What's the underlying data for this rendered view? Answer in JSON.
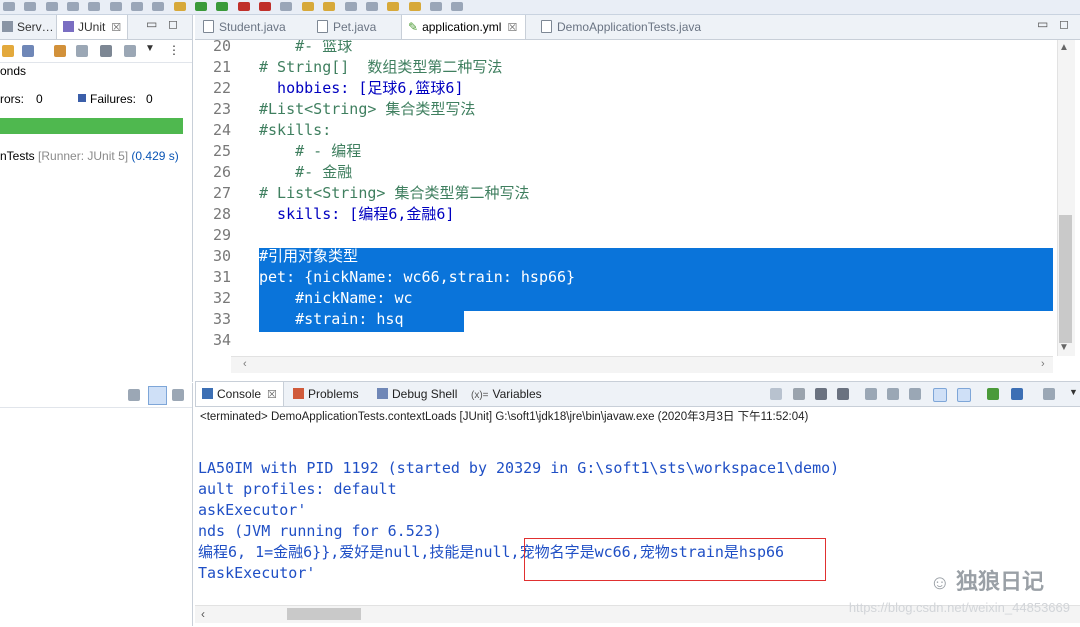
{
  "left_panel": {
    "tabs": [
      {
        "label": "Serv…"
      },
      {
        "label": "JUnit"
      }
    ],
    "elapsed_label": "onds",
    "errors_label": "rors:",
    "errors_value": "0",
    "failures_label": "Failures:",
    "failures_value": "0",
    "test_name": "nTests",
    "runner": "[Runner: JUnit 5]",
    "duration": "(0.429 s)"
  },
  "editor": {
    "tabs": [
      {
        "label": "Student.java",
        "active": false
      },
      {
        "label": "Pet.java",
        "active": false
      },
      {
        "label": "application.yml",
        "active": true
      },
      {
        "label": "DemoApplicationTests.java",
        "active": false
      }
    ],
    "lines": [
      {
        "num": "20",
        "text": "    #- 篮球",
        "cls": "cmt",
        "sel": false
      },
      {
        "num": "21",
        "text": "# String[]  数组类型第二种写法",
        "cls": "cmt",
        "sel": false
      },
      {
        "num": "22",
        "text": "  hobbies: [足球6,篮球6]",
        "cls": "key",
        "sel": false
      },
      {
        "num": "23",
        "text": "#List<String> 集合类型写法",
        "cls": "cmt",
        "sel": false
      },
      {
        "num": "24",
        "text": "#skills:",
        "cls": "cmt",
        "sel": false
      },
      {
        "num": "25",
        "text": "    # - 编程",
        "cls": "cmt",
        "sel": false
      },
      {
        "num": "26",
        "text": "    #- 金融",
        "cls": "cmt",
        "sel": false
      },
      {
        "num": "27",
        "text": "# List<String> 集合类型第二种写法",
        "cls": "cmt",
        "sel": false
      },
      {
        "num": "28",
        "text": "  skills: [编程6,金融6]",
        "cls": "key",
        "sel": false
      },
      {
        "num": "29",
        "text": "",
        "cls": "",
        "sel": false
      },
      {
        "num": "30",
        "text": "#引用对象类型",
        "cls": "cmt",
        "sel": true
      },
      {
        "num": "31",
        "text": "pet: {nickName: wc66,strain: hsp66}",
        "cls": "key",
        "sel": true
      },
      {
        "num": "32",
        "text": "    #nickName: wc",
        "cls": "cmt",
        "sel": true
      },
      {
        "num": "33",
        "text": "    #strain: hsq",
        "cls": "cmt",
        "sel": true
      },
      {
        "num": "34",
        "text": "",
        "cls": "",
        "sel": false
      }
    ]
  },
  "console": {
    "tabs": [
      {
        "label": "Console",
        "active": true
      },
      {
        "label": "Problems",
        "active": false
      },
      {
        "label": "Debug Shell",
        "active": false
      },
      {
        "label": "Variables",
        "active": false
      }
    ],
    "terminated": "<terminated> DemoApplicationTests.contextLoads [JUnit] G:\\soft1\\jdk18\\jre\\bin\\javaw.exe (2020年3月3日 下午11:52:04)",
    "output": [
      "LA50IM with PID 1192 (started by 20329 in G:\\soft1\\sts\\workspace1\\demo)",
      "ault profiles: default",
      "askExecutor'",
      "nds (JVM running for 6.523)",
      "编程6, 1=金融6}},爱好是null,技能是null,宠物名字是wc66,宠物strain是hsp66",
      "TaskExecutor'"
    ]
  },
  "watermark": {
    "text": "独狼日记",
    "url": "https://blog.csdn.net/weixin_44853669"
  },
  "colors": {
    "selection": "#0a74da",
    "comment": "#3f7f5f",
    "key": "#0000c0",
    "console_text": "#1f4fc5",
    "progress": "#4fb84f",
    "highlight": "#e03030"
  }
}
